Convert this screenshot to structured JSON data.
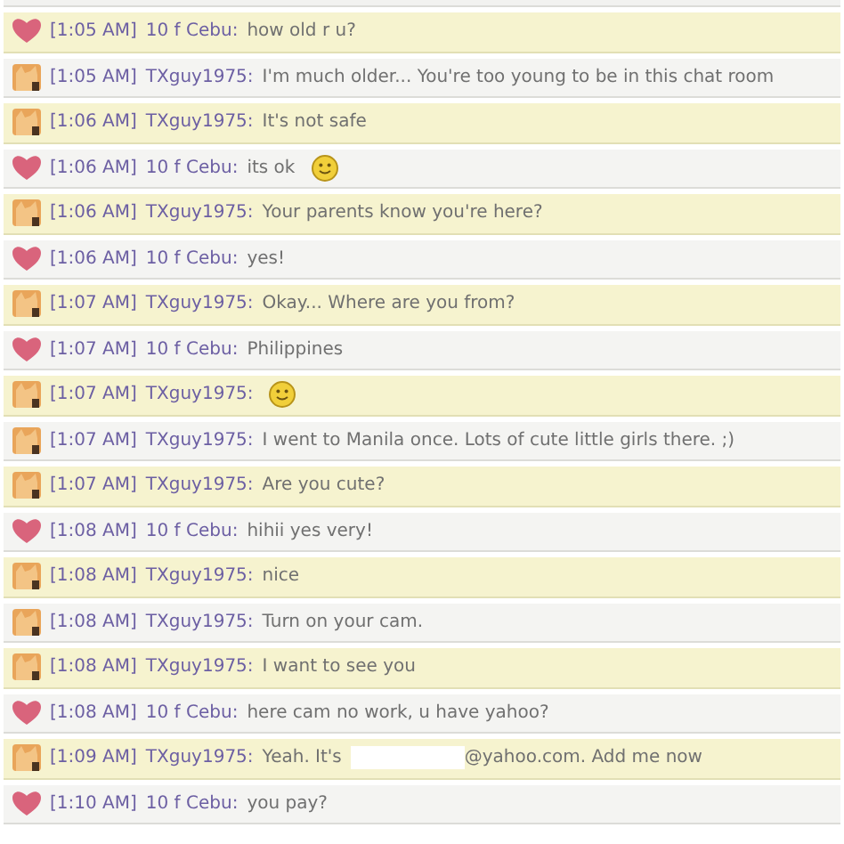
{
  "messages": [
    {
      "kind": "girl",
      "time": "[1:05 AM]",
      "sender": "10 f Cebu:",
      "text": "how old r u?"
    },
    {
      "kind": "guy",
      "time": "[1:05 AM]",
      "sender": "TXguy1975:",
      "text": "I'm much older... You're too young to be in this chat room"
    },
    {
      "kind": "guy",
      "time": "[1:06 AM]",
      "sender": "TXguy1975:",
      "text": "It's not safe"
    },
    {
      "kind": "girl",
      "time": "[1:06 AM]",
      "sender": "10 f Cebu:",
      "text": "its ok",
      "emoji": true
    },
    {
      "kind": "guy",
      "time": "[1:06 AM]",
      "sender": "TXguy1975:",
      "text": "Your parents know you're here?"
    },
    {
      "kind": "girl",
      "time": "[1:06 AM]",
      "sender": "10 f Cebu:",
      "text": "yes!"
    },
    {
      "kind": "guy",
      "time": "[1:07 AM]",
      "sender": "TXguy1975:",
      "text": "Okay... Where are you from?"
    },
    {
      "kind": "girl",
      "time": "[1:07 AM]",
      "sender": "10 f Cebu:",
      "text": "Philippines"
    },
    {
      "kind": "guy",
      "time": "[1:07 AM]",
      "sender": "TXguy1975:",
      "emoji": true
    },
    {
      "kind": "guy",
      "time": "[1:07 AM]",
      "sender": "TXguy1975:",
      "text": "I went to Manila once. Lots of cute little girls there. ;)"
    },
    {
      "kind": "guy",
      "time": "[1:07 AM]",
      "sender": "TXguy1975:",
      "text": "Are you cute?"
    },
    {
      "kind": "girl",
      "time": "[1:08 AM]",
      "sender": "10 f Cebu:",
      "text": "hihii yes very!"
    },
    {
      "kind": "guy",
      "time": "[1:08 AM]",
      "sender": "TXguy1975:",
      "text": "nice"
    },
    {
      "kind": "guy",
      "time": "[1:08 AM]",
      "sender": "TXguy1975:",
      "text": "Turn on your cam."
    },
    {
      "kind": "guy",
      "time": "[1:08 AM]",
      "sender": "TXguy1975:",
      "text": "I want to see you"
    },
    {
      "kind": "girl",
      "time": "[1:08 AM]",
      "sender": "10 f Cebu:",
      "text": "here cam no work, u have yahoo?"
    },
    {
      "kind": "guy",
      "time": "[1:09 AM]",
      "sender": "TXguy1975:",
      "text": "Yeah. It's",
      "redacted": true,
      "text_after": "@yahoo.com. Add me now"
    },
    {
      "kind": "girl",
      "time": "[1:10 AM]",
      "sender": "10 f Cebu:",
      "text": "you pay?"
    }
  ]
}
